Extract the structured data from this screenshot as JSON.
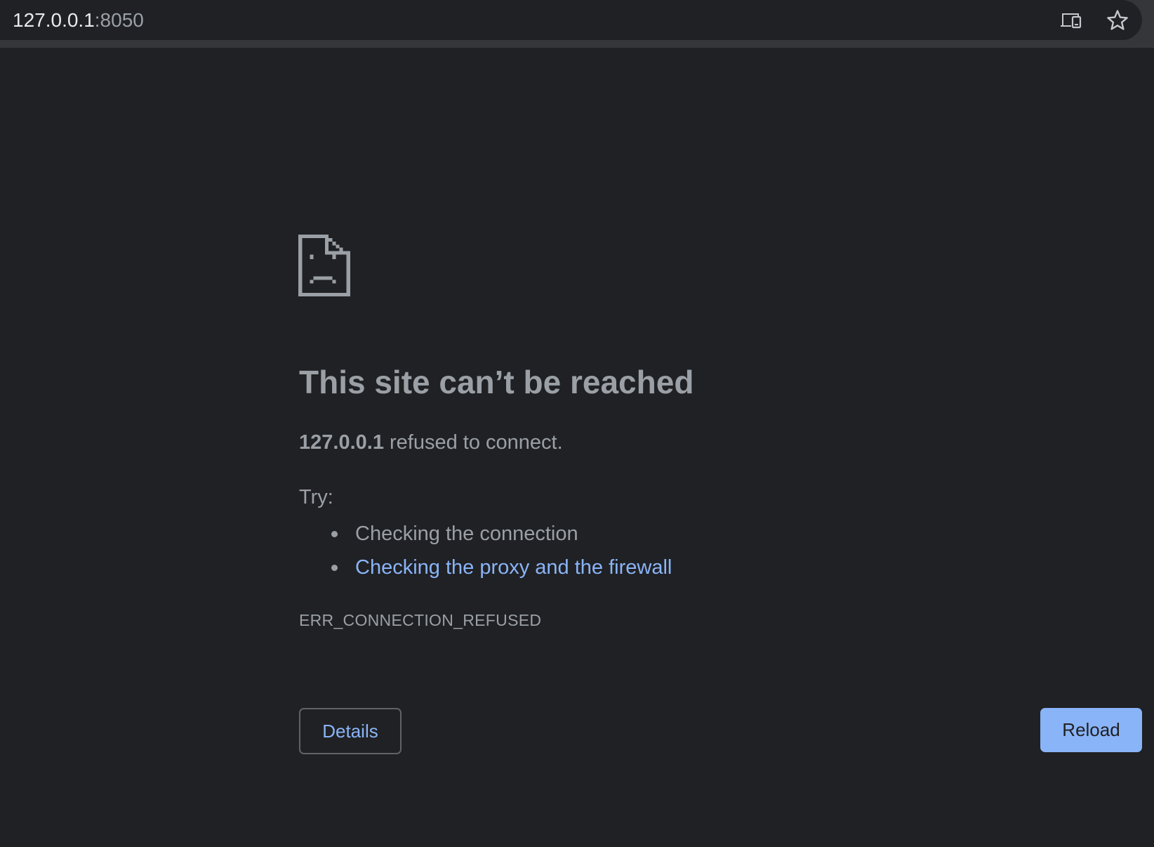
{
  "browser": {
    "url_host": "127.0.0.1",
    "url_port": ":8050",
    "icons": {
      "cast": "cast-devices-icon",
      "bookmark": "star-icon"
    }
  },
  "error_page": {
    "icon": "sad-page-icon",
    "title": "This site can’t be reached",
    "host": "127.0.0.1",
    "message": " refused to connect.",
    "try_label": "Try:",
    "suggestions": [
      "Checking the connection",
      "Checking the proxy and the firewall"
    ],
    "error_code": "ERR_CONNECTION_REFUSED",
    "details_label": "Details",
    "reload_label": "Reload"
  },
  "colors": {
    "background": "#202124",
    "text": "#9aa0a6",
    "link": "#8ab4f8",
    "button_primary": "#8ab4f8"
  }
}
